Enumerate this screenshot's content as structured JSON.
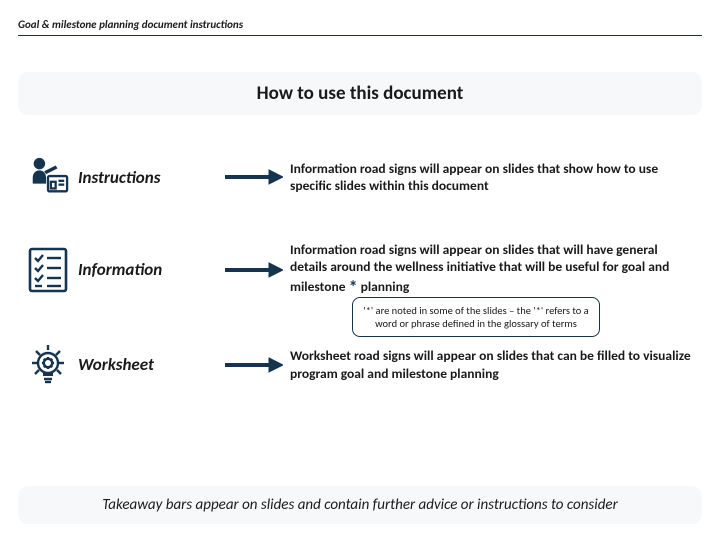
{
  "header": {
    "running_title": "Goal & milestone planning document instructions"
  },
  "title": "How to use this document",
  "rows": [
    {
      "label": "Instructions",
      "desc": "Information road signs will appear on slides that show how to use specific slides within this document"
    },
    {
      "label": "Information",
      "desc_pre": "Information road signs will appear on slides that will have general details around the wellness initiative that will be useful for goal and milestone",
      "asterisk": "*",
      "desc_post": " planning",
      "callout": "'*' are noted in some of the slides – the '*' refers to a word or phrase defined in the glossary of terms"
    },
    {
      "label": "Worksheet",
      "desc": "Worksheet road signs will appear on slides that can be filled to visualize program goal and milestone planning"
    }
  ],
  "footer": "Takeaway bars appear on slides and contain further advice or instructions to consider",
  "colors": {
    "brand": "#15344f"
  }
}
